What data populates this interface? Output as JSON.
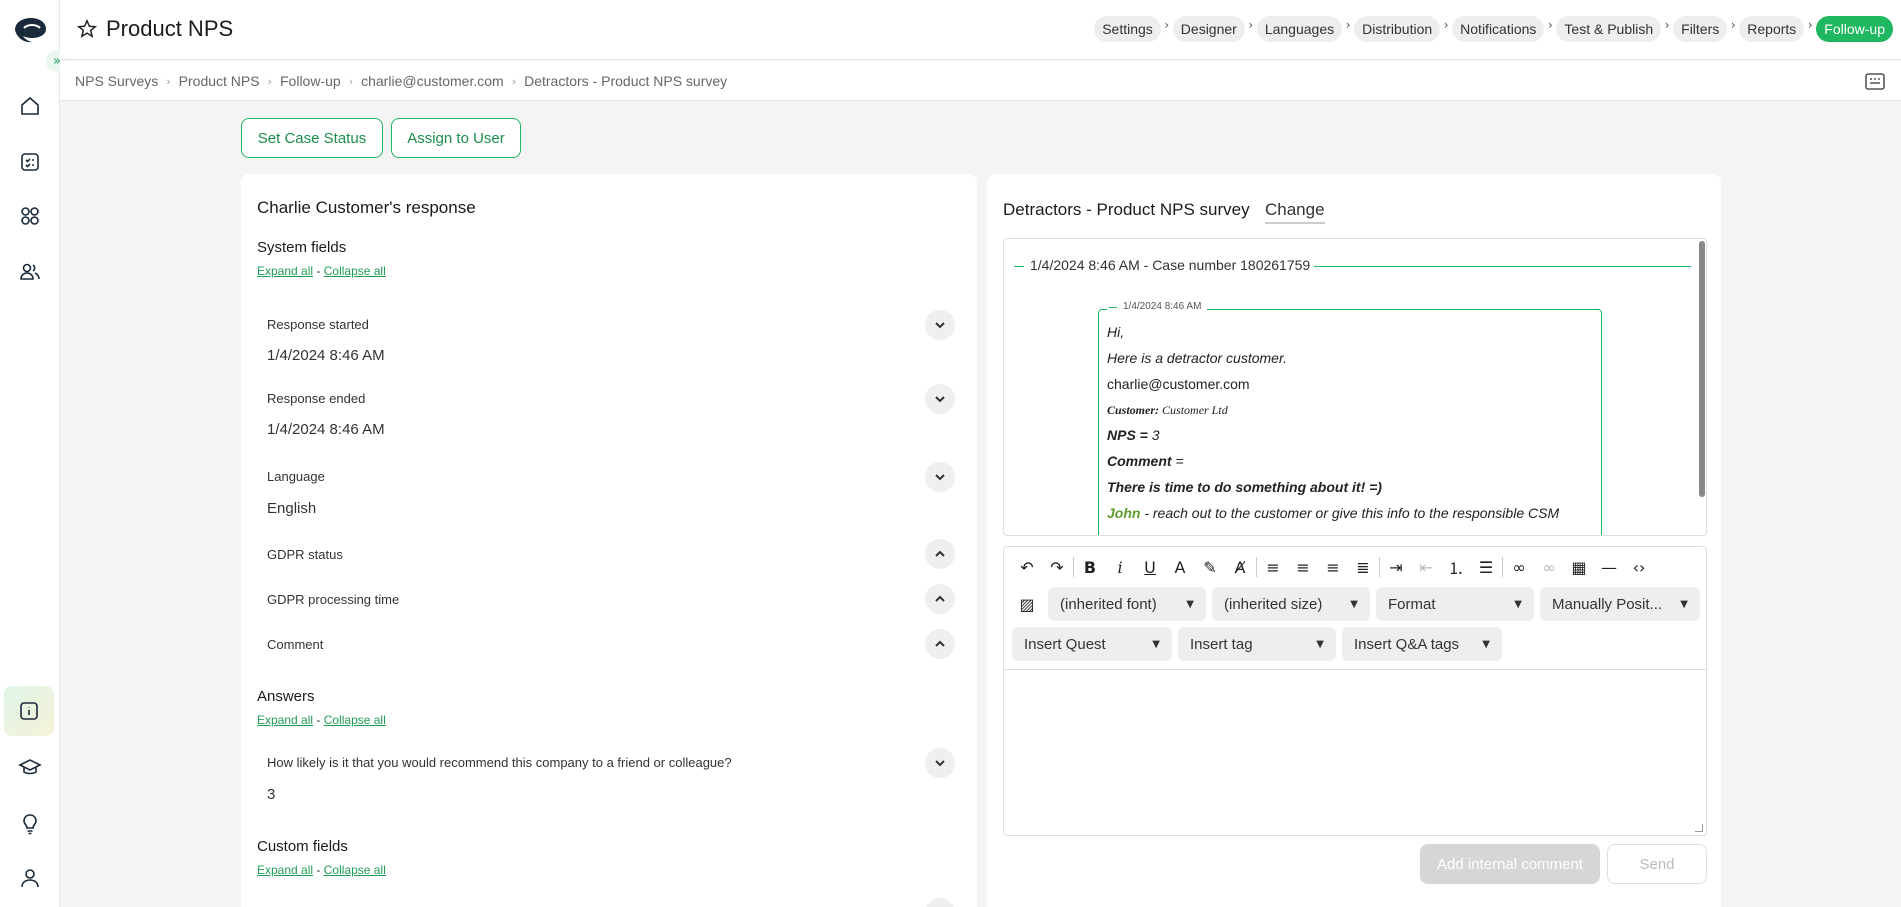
{
  "app": {
    "title": "Product NPS"
  },
  "steps": [
    {
      "label": "Settings",
      "active": false
    },
    {
      "label": "Designer",
      "active": false
    },
    {
      "label": "Languages",
      "active": false
    },
    {
      "label": "Distribution",
      "active": false
    },
    {
      "label": "Notifications",
      "active": false
    },
    {
      "label": "Test & Publish",
      "active": false
    },
    {
      "label": "Filters",
      "active": false
    },
    {
      "label": "Reports",
      "active": false
    },
    {
      "label": "Follow-up",
      "active": true
    }
  ],
  "breadcrumb": [
    "NPS Surveys",
    "Product NPS",
    "Follow-up",
    "charlie@customer.com",
    "Detractors - Product NPS survey"
  ],
  "actions": {
    "set_case_status": "Set Case Status",
    "assign_to_user": "Assign to User"
  },
  "response": {
    "title": "Charlie Customer's response",
    "system_fields_title": "System fields",
    "expand_all": "Expand all",
    "dash": "-",
    "collapse_all": "Collapse all",
    "fields": [
      {
        "label": "Response started",
        "value": "1/4/2024 8:46 AM",
        "expanded": true
      },
      {
        "label": "Response ended",
        "value": "1/4/2024 8:46 AM",
        "expanded": true
      },
      {
        "label": "Language",
        "value": "English",
        "expanded": true
      },
      {
        "label": "GDPR status",
        "value": "",
        "expanded": false
      },
      {
        "label": "GDPR processing time",
        "value": "",
        "expanded": false
      },
      {
        "label": "Comment",
        "value": "",
        "expanded": false
      }
    ],
    "answers_title": "Answers",
    "question": "How likely is it that you would recommend this company to a friend or colleague?",
    "answer": "3",
    "custom_fields_title": "Custom fields"
  },
  "case": {
    "survey_title": "Detractors - Product NPS survey",
    "change_label": "Change",
    "case_header": "1/4/2024 8:46 AM - Case number 180261759",
    "message_time": "1/4/2024 8:46 AM",
    "message_lines": {
      "hi": "Hi,",
      "detractor": "Here is a detractor customer.",
      "email": "charlie@customer.com",
      "customer_label": "Customer:",
      "customer_value": "Customer Ltd",
      "nps_label": "NPS =",
      "nps_value": "3",
      "comment_label": "Comment",
      "comment_eq": "=",
      "time_line": "There is time to do something about it! =)",
      "john_name": "John",
      "john_text": "- reach out to the customer or give this info to the responsible CSM"
    }
  },
  "editor": {
    "font_select": "(inherited font)",
    "size_select": "(inherited size)",
    "format_select": "Format",
    "position_select": "Manually Posit...",
    "insert_quest": "Insert Quest",
    "insert_tag": "Insert tag",
    "insert_qa_tags": "Insert Q&A tags"
  },
  "footer": {
    "add_internal_comment": "Add internal comment",
    "send": "Send"
  },
  "colors": {
    "accent": "#1fb860",
    "link": "#1f9d55",
    "john": "#5c9b2a"
  }
}
